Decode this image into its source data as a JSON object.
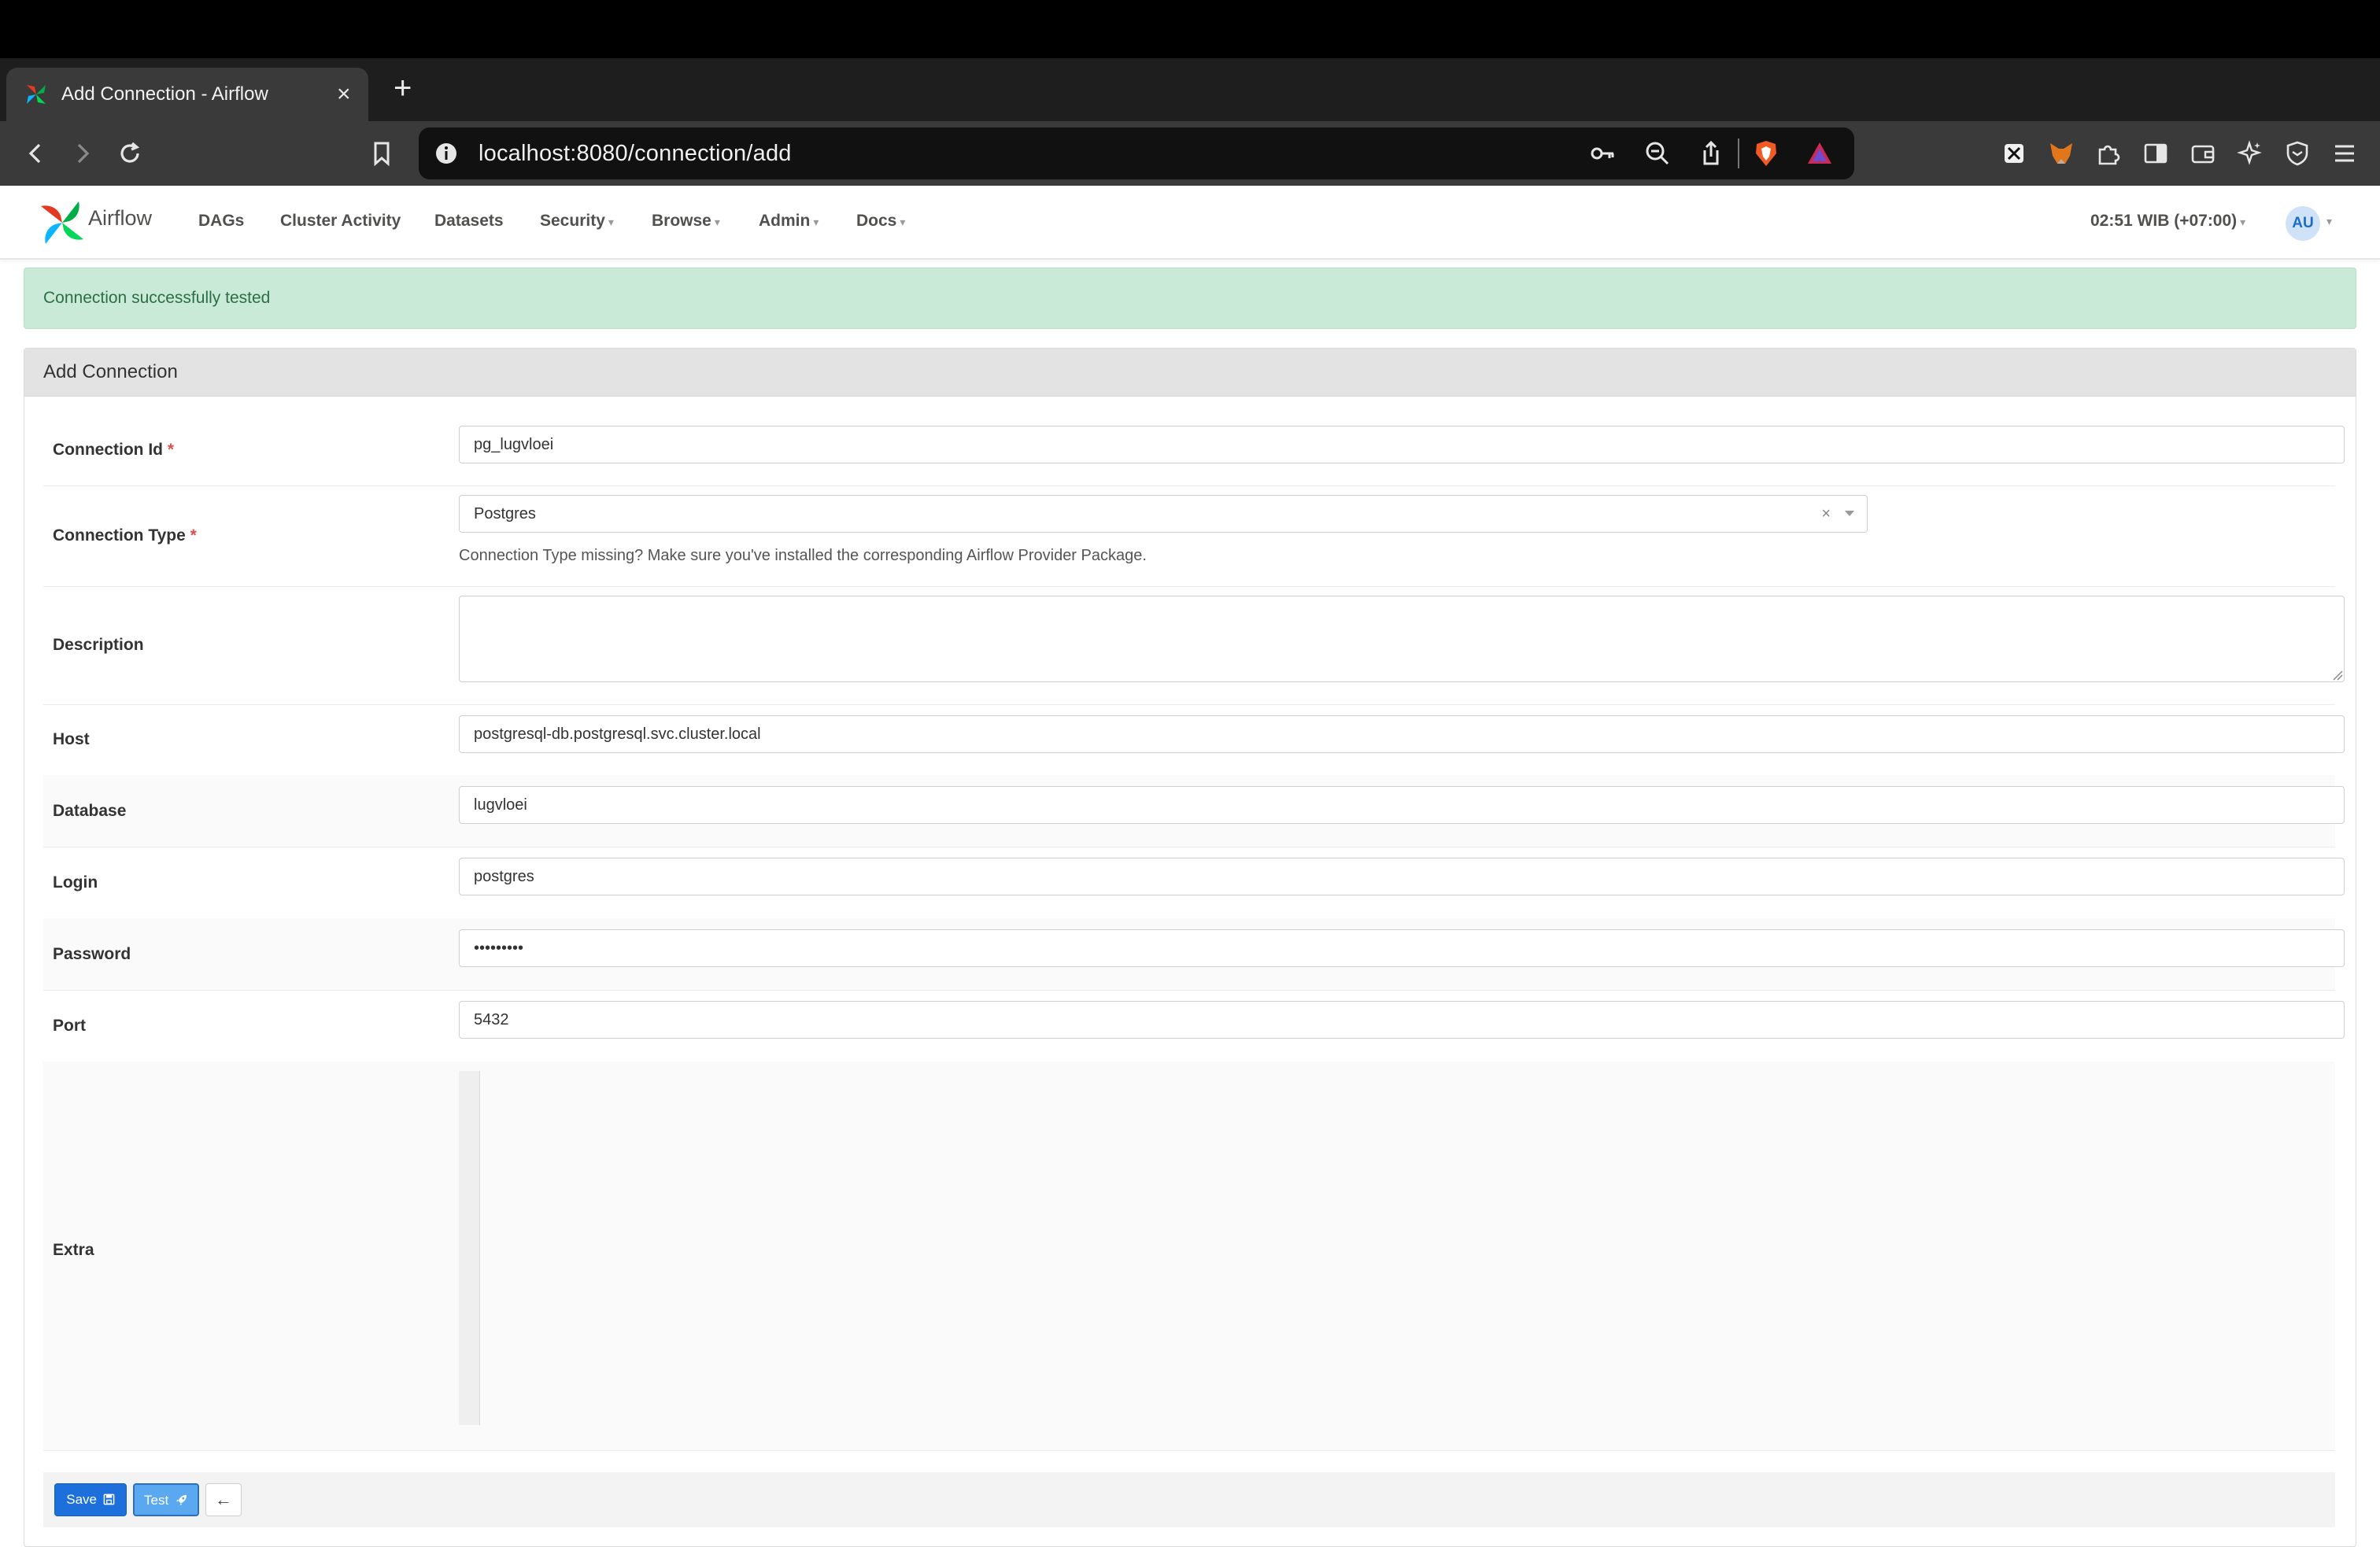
{
  "browser": {
    "tab_title": "Add Connection - Airflow",
    "tab_close": "×",
    "new_tab": "+",
    "url": "localhost:8080/connection/add"
  },
  "navbar": {
    "brand": "Airflow",
    "items": [
      {
        "label": "DAGs"
      },
      {
        "label": "Cluster Activity"
      },
      {
        "label": "Datasets"
      },
      {
        "label": "Security"
      },
      {
        "label": "Browse"
      },
      {
        "label": "Admin"
      },
      {
        "label": "Docs"
      }
    ],
    "time": "02:51 WIB (+07:00)",
    "avatar_initials": "AU"
  },
  "alert": {
    "message": "Connection successfully tested"
  },
  "form": {
    "title": "Add Connection",
    "required_mark": "*",
    "fields": {
      "conn_id": {
        "label": "Connection Id",
        "value": "pg_lugvloei"
      },
      "conn_type": {
        "label": "Connection Type",
        "value": "Postgres",
        "clear": "×",
        "help": "Connection Type missing? Make sure you've installed the corresponding Airflow Provider Package."
      },
      "description": {
        "label": "Description",
        "value": ""
      },
      "host": {
        "label": "Host",
        "value": "postgresql-db.postgresql.svc.cluster.local"
      },
      "database": {
        "label": "Database",
        "value": "lugvloei"
      },
      "login": {
        "label": "Login",
        "value": "postgres"
      },
      "password": {
        "label": "Password",
        "value": "•••••••••"
      },
      "port": {
        "label": "Port",
        "value": "5432"
      },
      "extra": {
        "label": "Extra",
        "value": ""
      }
    },
    "buttons": {
      "save": "Save",
      "test": "Test",
      "back": "←"
    }
  }
}
